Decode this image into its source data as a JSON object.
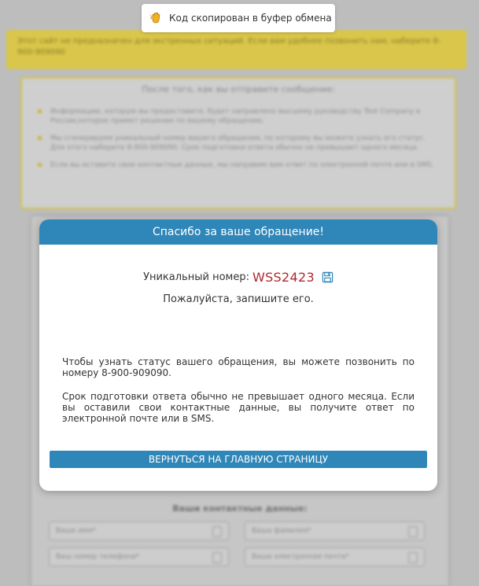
{
  "toast": {
    "text": "Код скопирован в буфер обмена",
    "icon": "clapping-hand-icon"
  },
  "background": {
    "notice": "Этот сайт не предназначен для экстренных ситуаций. Если вам удобнее позвонить нам, наберите 8-900-909090",
    "after_title": "После того, как вы отправите сообщение:",
    "after_items": [
      "Информацию, которую вы предоставите, будет направлено высшему руководству Test Company в России,которое примет решение по вашему обращению.",
      "Мы сгенерируем уникальный номер вашего обращения, по которому вы можете узнать его статус. Для этого наберите 8-900-909090. Срок подготовки ответа обычно не превышает одного месяца.",
      "Если вы оставите свои контактные данные, мы направим вам ответ по электронной почте или в SMS."
    ],
    "contact_title": "Ваши контактные данные:",
    "fields": {
      "name": "Ваше имя*",
      "surname": "Ваша фамилия*",
      "phone": "Ваш номер телефона*",
      "email": "Ваша электронная почта*"
    }
  },
  "modal": {
    "title": "Спасибо за ваше обращение!",
    "uid_label": "Уникальный номер:",
    "uid_value": "WSS2423",
    "please": "Пожалуйста, запишите его.",
    "info1": "Чтобы узнать статус вашего обращения, вы можете позвонить по номеру 8-900-909090.",
    "info2": "Срок подготовки ответа обычно не превышает одного месяца. Если вы оставили свои контактные данные, вы получите ответ по электронной почте или в SMS.",
    "back_button": "ВЕРНУТЬСЯ НА ГЛАВНУЮ СТРАНИЦУ"
  },
  "colors": {
    "accent": "#2f86b8",
    "uid": "#b0282e",
    "notice": "#d9c64a"
  }
}
